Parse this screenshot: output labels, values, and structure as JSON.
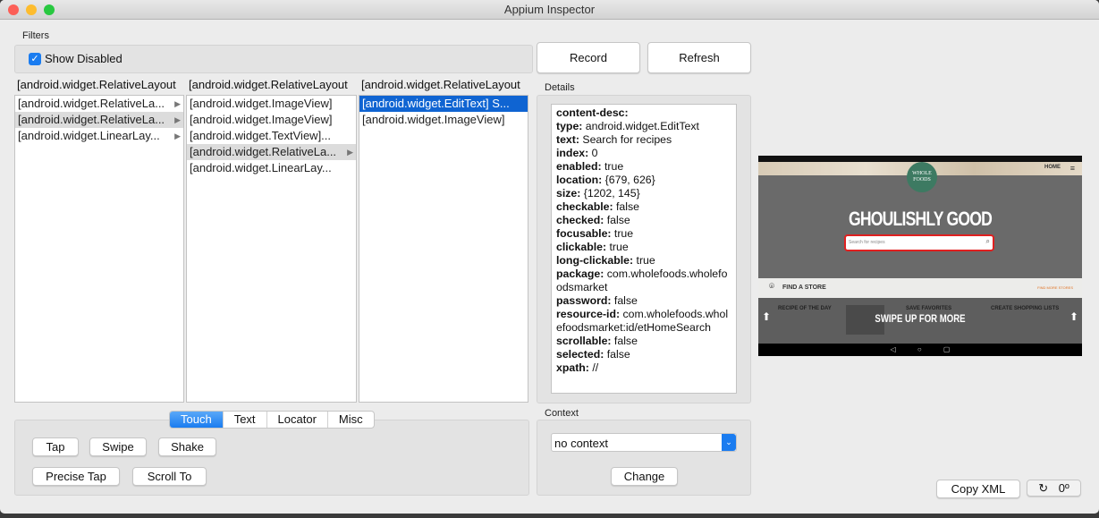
{
  "window": {
    "title": "Appium Inspector"
  },
  "filters": {
    "label": "Filters",
    "show_disabled_label": "Show Disabled",
    "show_disabled_checked": true
  },
  "toolbar": {
    "record_label": "Record",
    "refresh_label": "Refresh"
  },
  "tree": {
    "columns": [
      {
        "header": "[android.widget.RelativeLayout",
        "items": [
          {
            "label": "[android.widget.RelativeLa...",
            "has_children": true,
            "state": "normal"
          },
          {
            "label": "[android.widget.RelativeLa...",
            "has_children": true,
            "state": "selected"
          },
          {
            "label": "[android.widget.LinearLay...",
            "has_children": true,
            "state": "normal"
          }
        ]
      },
      {
        "header": "[android.widget.RelativeLayout",
        "items": [
          {
            "label": "[android.widget.ImageView]",
            "has_children": false,
            "state": "normal"
          },
          {
            "label": "[android.widget.ImageView]",
            "has_children": false,
            "state": "normal"
          },
          {
            "label": "[android.widget.TextView]...",
            "has_children": false,
            "state": "normal"
          },
          {
            "label": "[android.widget.RelativeLa...",
            "has_children": true,
            "state": "selected"
          },
          {
            "label": "[android.widget.LinearLay...",
            "has_children": false,
            "state": "normal"
          }
        ]
      },
      {
        "header": "[android.widget.RelativeLayout",
        "items": [
          {
            "label": "[android.widget.EditText] S...",
            "has_children": false,
            "state": "active"
          },
          {
            "label": "[android.widget.ImageView]",
            "has_children": false,
            "state": "normal"
          }
        ]
      }
    ]
  },
  "details": {
    "label": "Details",
    "lines": [
      {
        "k": "content-desc:",
        "v": ""
      },
      {
        "k": "type:",
        "v": " android.widget.EditText"
      },
      {
        "k": "text:",
        "v": " Search for recipes"
      },
      {
        "k": "index:",
        "v": " 0"
      },
      {
        "k": "enabled:",
        "v": " true"
      },
      {
        "k": "location:",
        "v": " {679, 626}"
      },
      {
        "k": "size:",
        "v": " {1202, 145}"
      },
      {
        "k": "checkable:",
        "v": " false"
      },
      {
        "k": "checked:",
        "v": " false"
      },
      {
        "k": "focusable:",
        "v": " true"
      },
      {
        "k": "clickable:",
        "v": " true"
      },
      {
        "k": "long-clickable:",
        "v": " true"
      },
      {
        "k": "package:",
        "v": " com.wholefoods.wholefoodsmarket"
      },
      {
        "k": "password:",
        "v": " false"
      },
      {
        "k": "resource-id:",
        "v": " com.wholefoods.wholefoodsmarket:id/etHomeSearch"
      },
      {
        "k": "scrollable:",
        "v": " false"
      },
      {
        "k": "selected:",
        "v": " false"
      },
      {
        "k": "xpath:",
        "v": " //"
      }
    ]
  },
  "actions": {
    "tabs": [
      {
        "label": "Touch",
        "active": true
      },
      {
        "label": "Text"
      },
      {
        "label": "Locator"
      },
      {
        "label": "Misc"
      }
    ],
    "buttons": {
      "tap": "Tap",
      "swipe": "Swipe",
      "shake": "Shake",
      "precise_tap": "Precise Tap",
      "scroll_to": "Scroll To"
    }
  },
  "context": {
    "label": "Context",
    "selected": "no context",
    "change_label": "Change"
  },
  "footer": {
    "copy_xml_label": "Copy XML",
    "rotation": "0º"
  },
  "device": {
    "logo": "WHOLE FOODS",
    "headline": "GHOULISHLY GOOD",
    "search_placeholder": "Search for recipes",
    "home": "HOME",
    "find_store": "FIND A STORE",
    "find_more": "FIND MORE STORES",
    "recipe": "RECIPE OF THE DAY",
    "favorites": "SAVE FAVORITES",
    "shopping": "CREATE SHOPPING LISTS",
    "swipe": "SWIPE UP FOR MORE",
    "highlight_color": "#e02020",
    "accent": "#0f64d2"
  }
}
